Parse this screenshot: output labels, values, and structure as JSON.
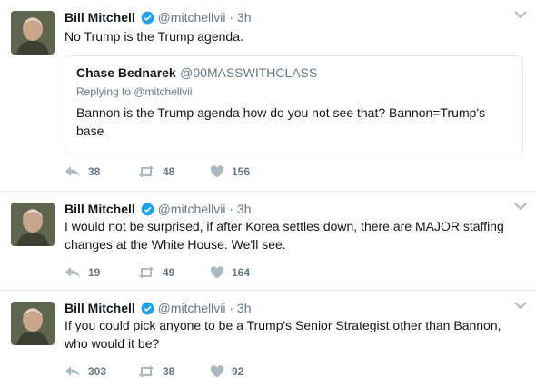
{
  "tweets": [
    {
      "name": "Bill Mitchell",
      "handle": "@mitchellvii",
      "time": "· 3h",
      "text": "No Trump is the Trump agenda.",
      "quote": {
        "name": "Chase Bednarek",
        "handle": "@00MASSWITHCLASS",
        "reply": "Replying to @mitchellvii",
        "text": "Bannon is the Trump agenda how do you not see that? Bannon=Trump's base"
      },
      "replies": "38",
      "retweets": "48",
      "likes": "156"
    },
    {
      "name": "Bill Mitchell",
      "handle": "@mitchellvii",
      "time": "· 3h",
      "text": "I would not be surprised, if after Korea settles down, there are MAJOR staffing changes at the White House.  We'll see.",
      "replies": "19",
      "retweets": "49",
      "likes": "164"
    },
    {
      "name": "Bill Mitchell",
      "handle": "@mitchellvii",
      "time": "· 3h",
      "text": "If you could pick anyone to be a Trump's Senior Strategist other than Bannon, who would it be?",
      "replies": "303",
      "retweets": "38",
      "likes": "92"
    }
  ],
  "colors": {
    "verified": "#1da1f2",
    "muted": "#657786",
    "border": "#e6ecf0"
  },
  "icons": [
    "chevron-down-icon",
    "reply-icon",
    "retweet-icon",
    "heart-icon",
    "verified-badge-icon"
  ]
}
